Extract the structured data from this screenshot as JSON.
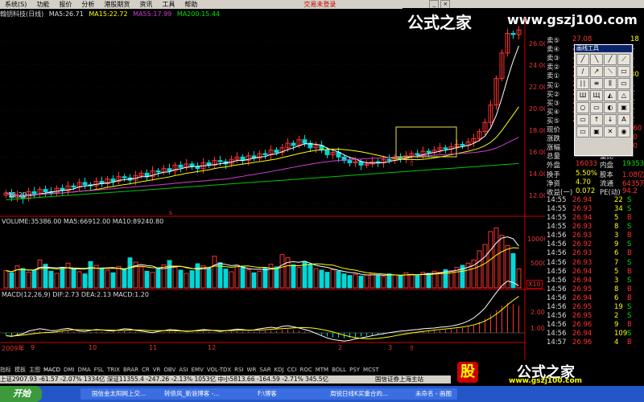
{
  "menu": {
    "items": [
      "系统(S)",
      "功能",
      "报价",
      "分析",
      "港股期货",
      "资讯",
      "工具",
      "帮助"
    ],
    "center_tag": "交易未登录"
  },
  "info": {
    "title": "翰钥科技(日线)",
    "ma5": "MA5:26.71",
    "ma15": "MA15:22.72",
    "ma55": "MA55:17.99",
    "ma200": "MA200:15.44"
  },
  "price_axis": [
    "26.00",
    "24.00",
    "22.00",
    "20.00",
    "18.00",
    "16.00",
    "14.00",
    "12.00"
  ],
  "price_low_marker": "12.20",
  "volume": {
    "header": "VOLUME:35386.00  MA5:66912.00  MA10:89240.80",
    "axis": [
      "10000",
      "5000"
    ],
    "unit": "X10"
  },
  "macd": {
    "header": "MACD(12,26,9)  DIF:2.73  DEA:2.13  MACD:1.20",
    "axis": [
      "2.00",
      "1.00"
    ]
  },
  "x_axis": {
    "year": "2009年",
    "months": [
      "9",
      "10",
      "11",
      "12",
      "2",
      "3"
    ]
  },
  "quote": {
    "sells": [
      {
        "label": "卖⑤",
        "price": "27.08",
        "vol": "18"
      },
      {
        "label": "卖④",
        "price": "27.07",
        "vol": "4"
      },
      {
        "label": "卖③",
        "price": "27.06",
        "vol": "1"
      },
      {
        "label": "卖②",
        "price": "27.02",
        "vol": "1"
      },
      {
        "label": "卖①",
        "price": "27.01",
        "vol": "80"
      }
    ],
    "buys": [
      {
        "label": "买①",
        "price": "27.00",
        "vol": "1"
      },
      {
        "label": "买②",
        "price": "26.98",
        "vol": "2"
      },
      {
        "label": "买③",
        "price": "26.97",
        "vol": "2"
      },
      {
        "label": "买④",
        "price": "26.96",
        "vol": "2"
      },
      {
        "label": "买⑤",
        "price": "26.95",
        "vol": "2"
      }
    ],
    "stats": [
      {
        "l1": "现价",
        "v1": "27.00",
        "l2": "今开",
        "v2": "26.60"
      },
      {
        "l1": "涨跌",
        "v1": "0.40",
        "l2": "最高",
        "v2": "27.0"
      },
      {
        "l1": "涨幅",
        "v1": "1.50%",
        "l2": "最低",
        "v2": "26.0"
      },
      {
        "l1": "总量",
        "v1": "35386",
        "l2": "量比",
        "v2": "0.0"
      },
      {
        "l1": "外盘",
        "v1": "16033",
        "l2": "内盘",
        "v2": "19353"
      },
      {
        "l1": "换手",
        "v1": "5.50%",
        "l2": "股本",
        "v2": "1.08亿"
      },
      {
        "l1": "净资",
        "v1": "4.70",
        "l2": "流通",
        "v2": "6435万"
      },
      {
        "l1": "收益(一)",
        "v1": "0.072",
        "l2": "PE(动)",
        "v2": "94.2"
      }
    ],
    "ticks": [
      {
        "t": "14:55",
        "p": "26.94",
        "v": "22",
        "s": "S"
      },
      {
        "t": "14:55",
        "p": "26.93",
        "v": "34",
        "s": "S"
      },
      {
        "t": "14:55",
        "p": "26.94",
        "v": "5",
        "s": "B"
      },
      {
        "t": "14:55",
        "p": "26.93",
        "v": "8",
        "s": "S"
      },
      {
        "t": "14:56",
        "p": "26.93",
        "v": "3",
        "s": "B"
      },
      {
        "t": "14:56",
        "p": "26.92",
        "v": "9",
        "s": "S"
      },
      {
        "t": "14:56",
        "p": "26.93",
        "v": "6",
        "s": "B"
      },
      {
        "t": "14:56",
        "p": "26.93",
        "v": "7",
        "s": "S"
      },
      {
        "t": "14:56",
        "p": "26.94",
        "v": "5",
        "s": "B"
      },
      {
        "t": "14:56",
        "p": "26.94",
        "v": "3",
        "s": "S"
      },
      {
        "t": "14:56",
        "p": "26.95",
        "v": "8",
        "s": "B"
      },
      {
        "t": "14:56",
        "p": "26.94",
        "v": "6",
        "s": "B"
      },
      {
        "t": "14:56",
        "p": "26.95",
        "v": "19",
        "s": "S"
      },
      {
        "t": "14:56",
        "p": "26.95",
        "v": "2",
        "s": "S"
      },
      {
        "t": "14:56",
        "p": "26.96",
        "v": "9",
        "s": "B"
      },
      {
        "t": "14:56",
        "p": "26.94",
        "v": "109",
        "s": "S"
      },
      {
        "t": "14:57",
        "p": "26.96",
        "v": "4",
        "s": "B"
      }
    ]
  },
  "toolbox": {
    "title": "画线工具",
    "tools": [
      "╱",
      "╲",
      "╱",
      "⟋",
      "∕",
      "↗",
      "⟍",
      "▭",
      "∣∣",
      "≡",
      "⫼",
      "▭",
      "Ш",
      "Щ",
      "◭",
      "△",
      "○",
      "▭",
      "◐",
      "▣",
      "▭",
      "↑",
      "↓",
      "A",
      "▭",
      "▣",
      "✕",
      "◉"
    ]
  },
  "tabs": [
    "指标",
    "模板",
    "主图",
    "MACD",
    "DMI",
    "DMA",
    "FSL",
    "TRIX",
    "BRAR",
    "CR",
    "VR",
    "OBV",
    "ASI",
    "EMV",
    "VOL-TDX",
    "RSI",
    "WR",
    "SAR",
    "KDJ",
    "CCI",
    "ROC",
    "MTM",
    "BOLL",
    "PSY",
    "MCST"
  ],
  "status": {
    "text": "上证2907.93 -61.57 -2.07% 1334亿 深证11355.4 -247.26 -2.13% 1053亿 中小5813.66 -164.59 -2.71% 345.5亿",
    "broker": "国信证券上海主站"
  },
  "taskbar": {
    "start": "开始",
    "tasks": [
      "国信金太阳网上交...",
      "转债风_新浪博客 -...",
      "F:\\博客",
      "周锐日线K买重合的...",
      "未命名 - 画图"
    ]
  },
  "watermark": {
    "cn": "公式之家",
    "url": "www.gszj100.com",
    "bottom_cn": "公式之家",
    "stock_char": "股"
  },
  "chart_data": [
    {
      "type": "candlestick",
      "title": "翰钥科技(日线)",
      "x_period": "2009-08 to 2010-03",
      "ylim": [
        11.5,
        27.5
      ],
      "close": [
        12.9,
        12.5,
        12.7,
        12.4,
        13.0,
        12.8,
        13.2,
        13.0,
        12.9,
        13.3,
        13.1,
        13.5,
        13.4,
        13.8,
        13.6,
        13.5,
        13.9,
        13.7,
        14.1,
        13.9,
        14.3,
        14.2,
        14.0,
        14.4,
        14.6,
        14.3,
        14.8,
        14.7,
        15.0,
        14.8,
        15.3,
        15.1,
        15.4,
        15.2,
        15.0,
        15.5,
        15.3,
        15.7,
        15.6,
        15.4,
        15.8,
        16.0,
        15.7,
        16.1,
        15.9,
        16.3,
        16.2,
        16.6,
        16.4,
        16.8,
        17.2,
        17.0,
        17.5,
        17.2,
        16.8,
        17.0,
        16.6,
        16.2,
        16.4,
        16.0,
        15.7,
        15.5,
        15.6,
        15.3,
        15.4,
        15.6,
        15.5,
        15.8,
        15.7,
        16.0,
        15.9,
        16.1,
        16.3,
        16.2,
        16.5,
        16.4,
        16.6,
        16.8,
        16.7,
        16.9,
        17.1,
        17.0,
        17.3,
        17.6,
        18.2,
        19.0,
        20.5,
        22.8,
        25.0,
        26.7,
        26.6,
        27.0
      ],
      "ma5_final": 26.71,
      "ma15_final": 22.72,
      "ma55_final": 17.99,
      "ma200_final": 15.44
    },
    {
      "type": "bar",
      "title": "VOLUME",
      "unit": "X10",
      "values": [
        3200,
        2800,
        4100,
        3600,
        2900,
        3300,
        5200,
        4400,
        3100,
        2700,
        3800,
        4600,
        3500,
        3000,
        2600,
        4900,
        4200,
        3700,
        3300,
        2800,
        4000,
        3400,
        5600,
        4800,
        3900,
        3100,
        2900,
        3600,
        4300,
        5100,
        3800,
        3300,
        2700,
        3200,
        4500,
        4100,
        3600,
        5900,
        4700,
        3500,
        3000,
        4200,
        3900,
        3400,
        2800,
        3100,
        3700,
        4400,
        3900,
        6200,
        5600,
        4300,
        3800,
        4900,
        4400,
        3600,
        3300,
        2900,
        3400,
        3100,
        2600,
        2300,
        2500,
        2200,
        2400,
        2700,
        2300,
        2100,
        2600,
        2400,
        2200,
        2800,
        2500,
        2300,
        2900,
        2700,
        3100,
        2900,
        3400,
        3200,
        3800,
        4200,
        4600,
        5200,
        6900,
        8100,
        10500,
        11200,
        9800,
        7900,
        6400,
        3538
      ],
      "ma5_final": 6691.2,
      "ma10_final": 8924.08
    },
    {
      "type": "bar",
      "title": "MACD",
      "values": [
        -0.1,
        -0.12,
        -0.08,
        -0.05,
        0.02,
        0.05,
        0.08,
        0.06,
        0.03,
        0.04,
        0.07,
        0.09,
        0.06,
        0.02,
        0.01,
        0.04,
        0.06,
        0.05,
        0.03,
        0.02,
        0.05,
        0.08,
        0.07,
        0.04,
        0.02,
        0.0,
        -0.02,
        0.01,
        0.03,
        0.06,
        0.05,
        0.03,
        0.01,
        0.02,
        0.04,
        0.06,
        0.05,
        0.03,
        0.01,
        0.03,
        0.05,
        0.07,
        0.06,
        0.04,
        0.05,
        0.08,
        0.1,
        0.12,
        0.1,
        0.14,
        0.16,
        0.13,
        0.1,
        0.06,
        0.02,
        -0.04,
        -0.1,
        -0.16,
        -0.2,
        -0.22,
        -0.24,
        -0.22,
        -0.18,
        -0.16,
        -0.13,
        -0.1,
        -0.07,
        -0.05,
        -0.02,
        0.0,
        0.02,
        0.03,
        0.05,
        0.06,
        0.08,
        0.09,
        0.1,
        0.12,
        0.13,
        0.15,
        0.18,
        0.22,
        0.28,
        0.36,
        0.48,
        0.62,
        0.82,
        1.02,
        1.2,
        1.32,
        1.28,
        1.2
      ],
      "dif_final": 2.73,
      "dea_final": 2.13,
      "macd_final": 1.2
    }
  ]
}
